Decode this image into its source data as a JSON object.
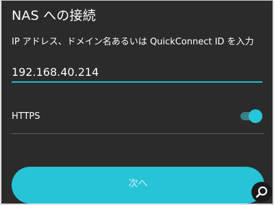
{
  "screen": {
    "title": "NAS への接続",
    "subtitle": "IP アドレス、ドメイン名あるいは QuickConnect ID を入力",
    "address_value": "192.168.40.214",
    "https_label": "HTTPS",
    "https_enabled": true,
    "next_label": "次へ"
  },
  "overlay": {
    "zoom_icon": "magnifier-icon"
  },
  "colors": {
    "background": "#2b2b2b",
    "accent": "#27c3d7",
    "toggle_track": "#3a7f88",
    "text": "#ffffff"
  }
}
